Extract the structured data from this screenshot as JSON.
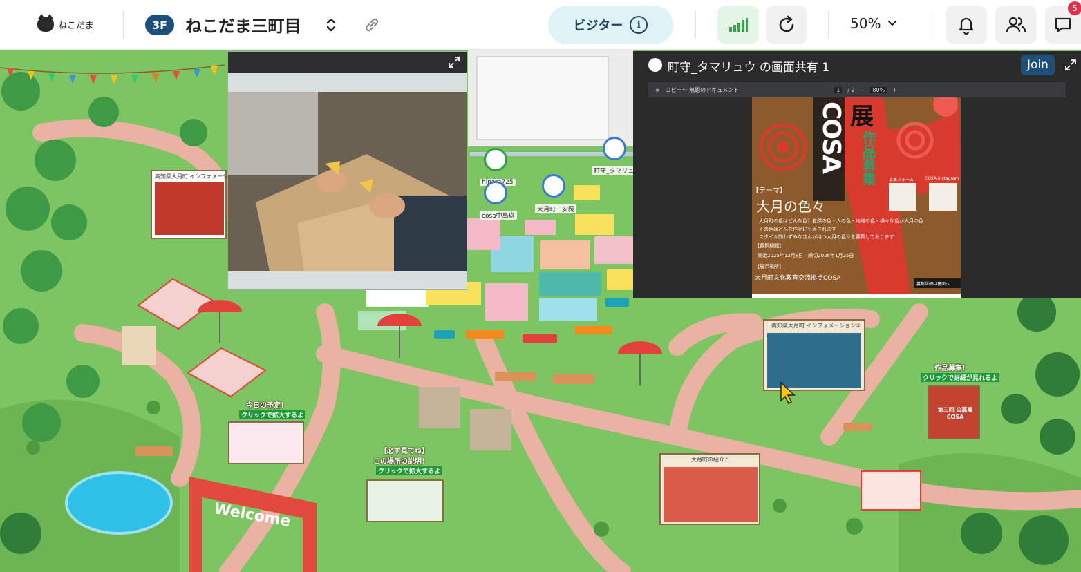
{
  "topbar": {
    "logo_text": "ねこだま",
    "floor": "3F",
    "space_title": "ねこだま三町目",
    "visitor_label": "ビジター",
    "zoom_level": "50%",
    "notification_count": "5",
    "icons": [
      "link-icon",
      "info-icon",
      "signal-icon",
      "refresh-icon",
      "chevron-down-icon",
      "bell-icon",
      "users-icon",
      "chat-icon"
    ]
  },
  "screen_share": {
    "title": "町守_タマリュウ の画面共有 1",
    "join_label": "Join",
    "doc_toolbar": {
      "doc_name": "コピー〜 無題のドキュメント",
      "page": "1",
      "page_total": "/ 2",
      "zoom": "80%"
    },
    "poster": {
      "headline": "展",
      "vertical_text": "作品募集",
      "brand": "COSA",
      "theme_label": "【テーマ】",
      "theme": "大月の色々",
      "body1": "大月町の色はどんな色？自然の色・人の色・地域の色・様々な色が大月の色",
      "body2": "その色はどんな作品にも表されます",
      "body3": "スタイル問わずみなさんが持つ大月の色々を募集しております",
      "period_label": "【募集期間】",
      "period": "開始2025年12月8日　締切2026年1月25日",
      "venue_label": "【展示場所】",
      "venue": "大月町文化教育交流拠点COSA",
      "form_label": "募集フォーム",
      "insta_label": "COSA Instagram",
      "footer": "募集詳細は裏面へ"
    }
  },
  "map": {
    "avatars": [
      {
        "name": "hinata725"
      },
      {
        "name": "cosa中島玖"
      },
      {
        "name": "大月町　安岡"
      },
      {
        "name": "町守_タマリュ"
      }
    ],
    "boards": {
      "info1_title": "高知県大月町 インフォメーション",
      "info2_title": "高知県大月町 インフォメーション②",
      "intro_title": "大月町の紹介♪",
      "schedule_title": "今日の予定！",
      "schedule_sub": "クリックで拡大するよ",
      "must_title": "【必ず見てね】",
      "must_title2": "この場所の説明！",
      "must_sub": "クリックで拡大するよ",
      "works_title": "作品募集！",
      "works_sub": "クリックで詳細が見れるよ",
      "works_poster": "第三回 公募展 COSA",
      "welcome": "Welcome"
    }
  },
  "colors": {
    "grass": "#7dc462",
    "path": "#e8b0a0",
    "accent_navy": "#1f4e79",
    "visitor_bg": "#dff3f6",
    "badge": "#e0314b",
    "poster_red": "#d83a2e"
  }
}
